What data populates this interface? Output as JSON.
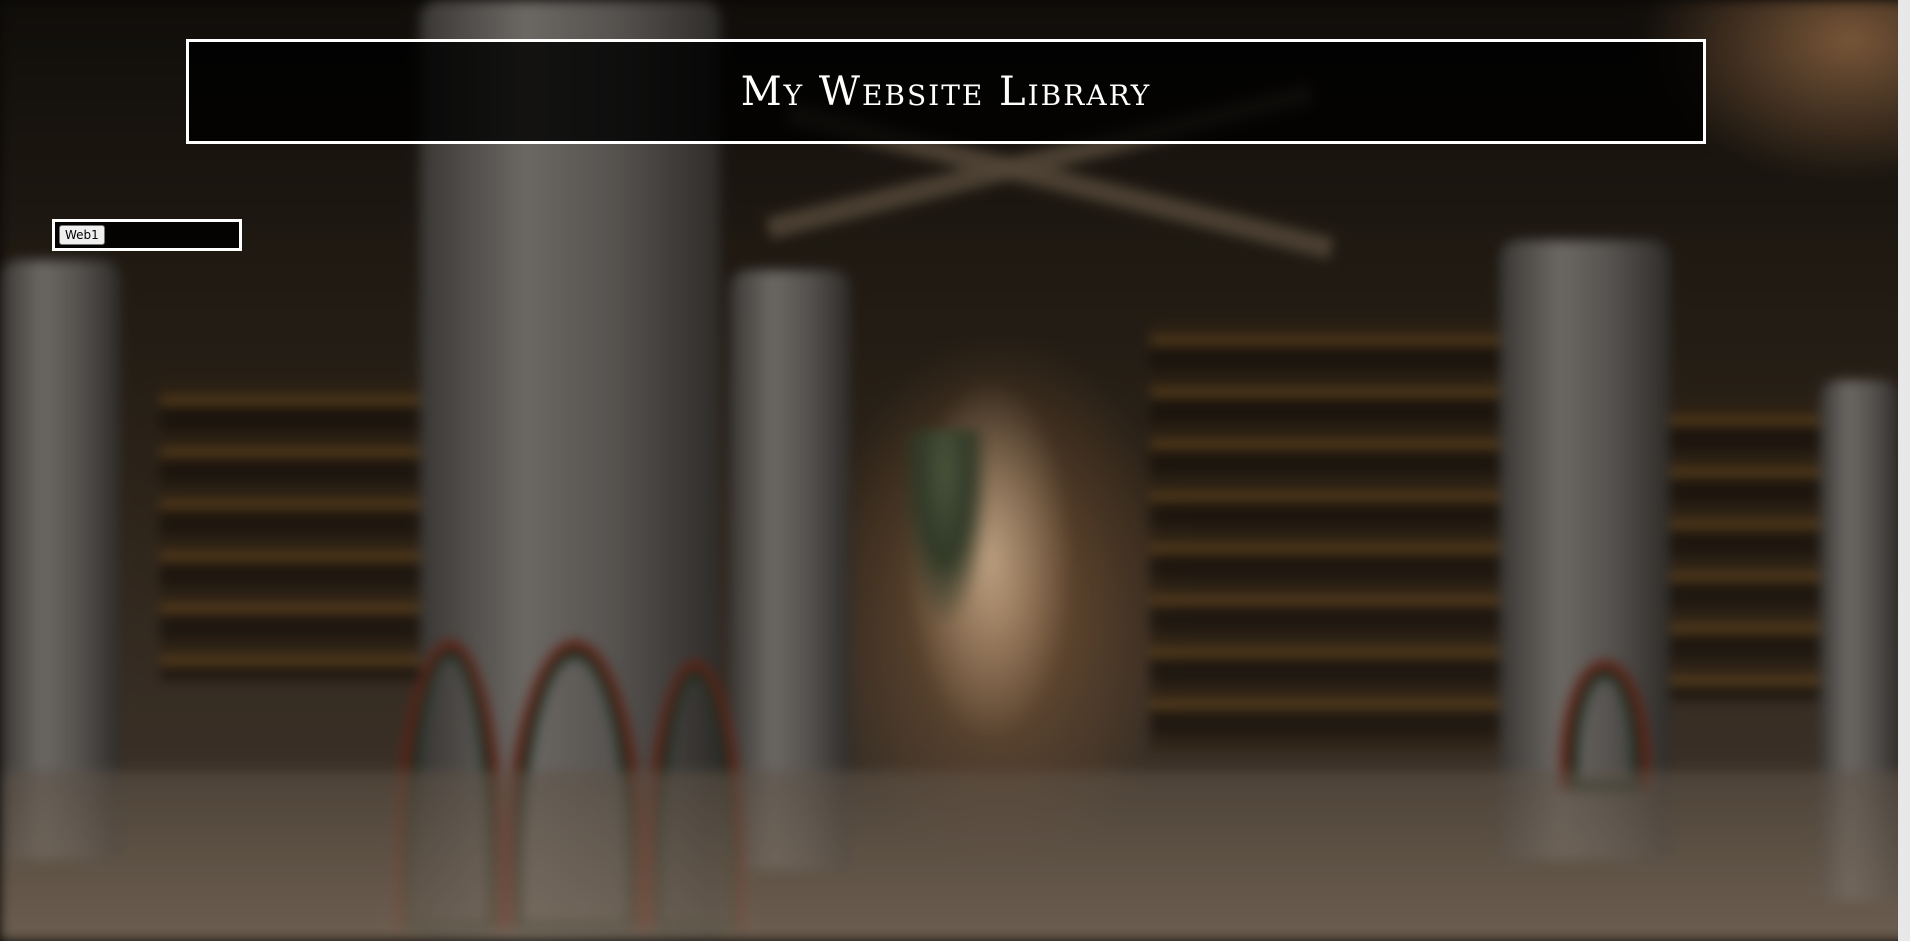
{
  "page": {
    "title": "My Website Library"
  },
  "website_list": {
    "items": [
      {
        "label": "Web1"
      }
    ]
  },
  "colors": {
    "header_border": "#ffffff",
    "panel_background": "#000000",
    "title_text": "#ffffff",
    "button_background": "#efefef"
  }
}
